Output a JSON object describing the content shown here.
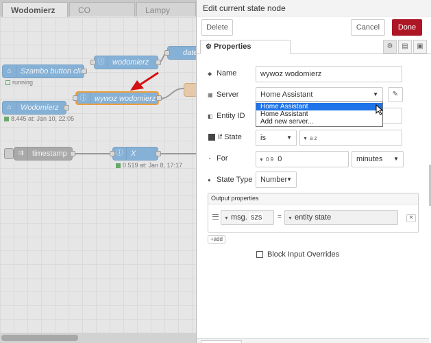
{
  "workspace": {
    "tabs": [
      {
        "label": "Wodomierz",
        "active": true
      },
      {
        "label": "CO",
        "active": false
      },
      {
        "label": "Lampy",
        "active": false
      }
    ],
    "nodes": {
      "szambo": {
        "label": "Szambo button click",
        "status": "running",
        "icon": "ha-icon"
      },
      "wodomierz_top": {
        "label": "wodomierz",
        "icon": "info-icon"
      },
      "date": {
        "label": "date",
        "icon": "function-icon"
      },
      "wywoz": {
        "label": "wywoz wodomierz",
        "icon": "info-icon"
      },
      "wodomierz_entity": {
        "label": "Wodomierz",
        "status": "8.445 at: Jan 10, 22:05",
        "icon": "ha-icon"
      },
      "timestamp": {
        "label": "timestamp",
        "icon": "inject-icon"
      },
      "x": {
        "label": "X",
        "status": "0.519 at: Jan 8, 17:17",
        "icon": "info-icon"
      }
    }
  },
  "panel": {
    "title": "Edit current state node",
    "delete_label": "Delete",
    "cancel_label": "Cancel",
    "done_label": "Done",
    "tab_properties": "Properties",
    "fields": {
      "name_label": "Name",
      "name_value": "wywoz wodomierz",
      "server_label": "Server",
      "server_value": "Home Assistant",
      "server_options": [
        "Home Assistant",
        "Home Assistant",
        "Add new server..."
      ],
      "entity_label": "Entity ID",
      "if_state_label": "If State",
      "if_state_op": "is",
      "if_state_type": "a z",
      "for_label": "For",
      "for_type": "0 9",
      "for_value": "0",
      "for_unit": "minutes",
      "state_type_label": "State Type",
      "state_type_value": "Number"
    },
    "output": {
      "title": "Output properties",
      "prop_type": "msg.",
      "prop_value": "szs",
      "equals": "=",
      "value_type": "entity state",
      "remove": "×",
      "add_label": "add"
    },
    "block_input_label": "Block Input Overrides"
  },
  "colors": {
    "done": "#ad1625",
    "node": "#86b1d6",
    "selected_option": "#1e73e8"
  }
}
